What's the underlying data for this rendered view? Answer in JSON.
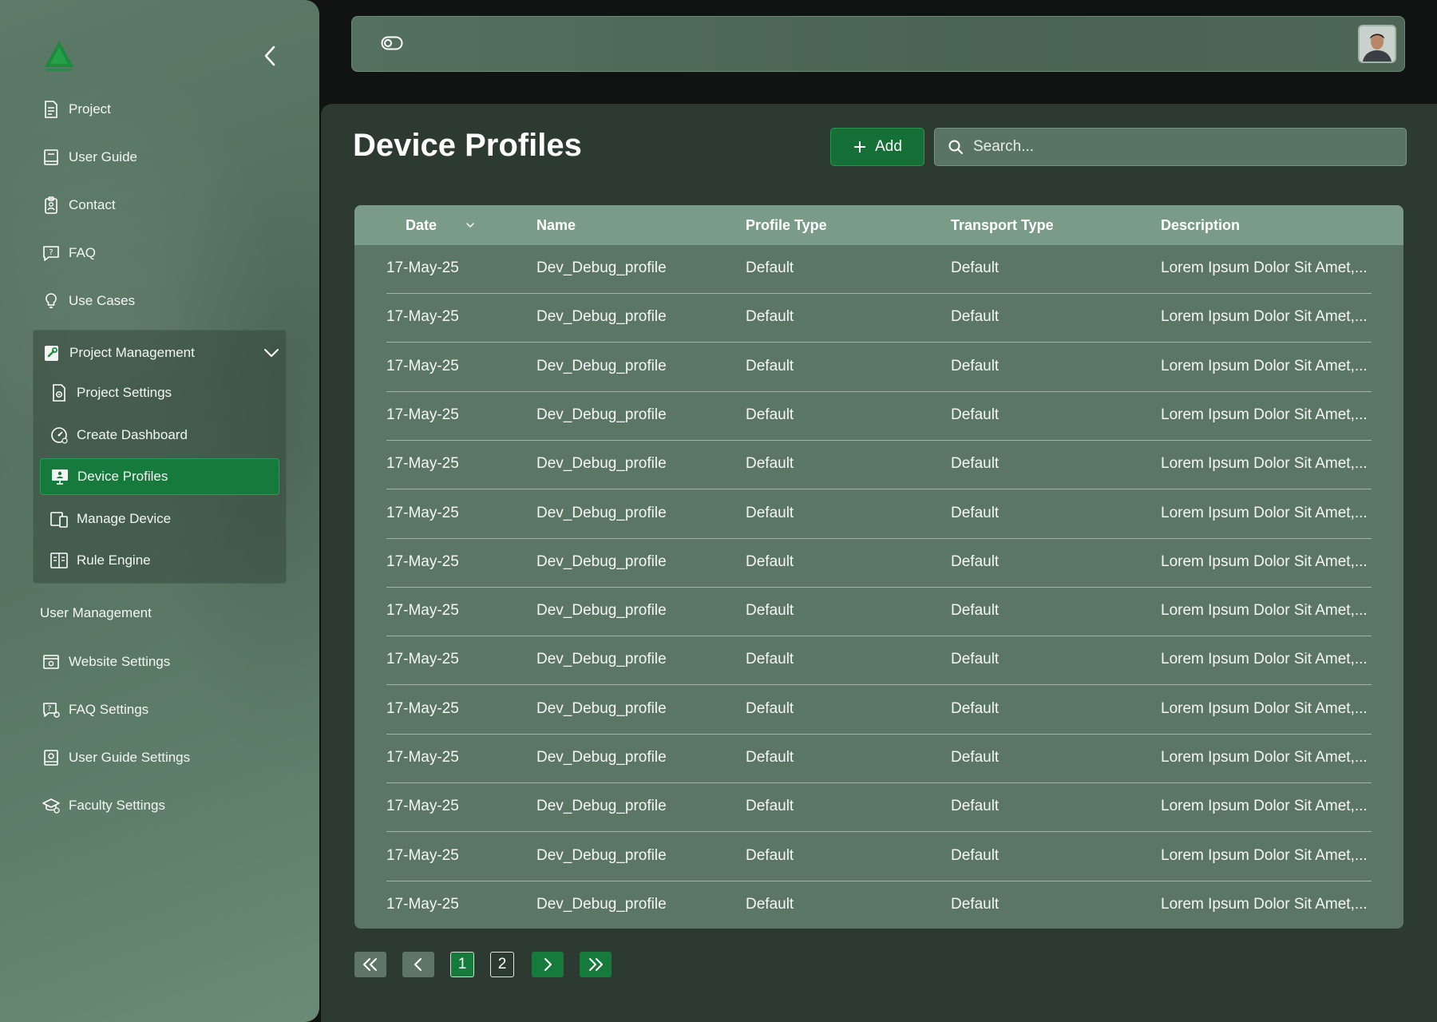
{
  "sidebar": {
    "items": [
      {
        "label": "Project",
        "icon": "document-icon"
      },
      {
        "label": "User Guide",
        "icon": "book-icon"
      },
      {
        "label": "Contact",
        "icon": "contact-card-icon"
      },
      {
        "label": "FAQ",
        "icon": "question-chat-icon"
      },
      {
        "label": "Use Cases",
        "icon": "lightbulb-icon"
      }
    ],
    "group": {
      "label": "Project Management",
      "icon": "wrench-document-icon",
      "items": [
        {
          "label": "Project Settings",
          "icon": "gear-document-icon"
        },
        {
          "label": "Create Dashboard",
          "icon": "gauge-icon"
        },
        {
          "label": "Device Profiles",
          "icon": "monitor-user-icon",
          "active": true
        },
        {
          "label": "Manage Device",
          "icon": "devices-icon"
        },
        {
          "label": "Rule Engine",
          "icon": "open-book-icon"
        }
      ]
    },
    "section_label": "User Management",
    "user_items": [
      {
        "label": "Website Settings",
        "icon": "browser-gear-icon"
      },
      {
        "label": "FAQ Settings",
        "icon": "question-gear-icon"
      },
      {
        "label": "User Guide Settings",
        "icon": "book-gear-icon"
      },
      {
        "label": "Faculty Settings",
        "icon": "graduation-cap-icon"
      }
    ]
  },
  "header": {
    "page_title": "Device Profiles",
    "add_label": "Add",
    "search_placeholder": "Search..."
  },
  "table": {
    "columns": [
      "Date",
      "Name",
      "Profile Type",
      "Transport Type",
      "Description"
    ],
    "rows": [
      [
        "17-May-25",
        "Dev_Debug_profile",
        "Default",
        "Default",
        "Lorem Ipsum Dolor Sit Amet,..."
      ],
      [
        "17-May-25",
        "Dev_Debug_profile",
        "Default",
        "Default",
        "Lorem Ipsum Dolor Sit Amet,..."
      ],
      [
        "17-May-25",
        "Dev_Debug_profile",
        "Default",
        "Default",
        "Lorem Ipsum Dolor Sit Amet,..."
      ],
      [
        "17-May-25",
        "Dev_Debug_profile",
        "Default",
        "Default",
        "Lorem Ipsum Dolor Sit Amet,..."
      ],
      [
        "17-May-25",
        "Dev_Debug_profile",
        "Default",
        "Default",
        "Lorem Ipsum Dolor Sit Amet,..."
      ],
      [
        "17-May-25",
        "Dev_Debug_profile",
        "Default",
        "Default",
        "Lorem Ipsum Dolor Sit Amet,..."
      ],
      [
        "17-May-25",
        "Dev_Debug_profile",
        "Default",
        "Default",
        "Lorem Ipsum Dolor Sit Amet,..."
      ],
      [
        "17-May-25",
        "Dev_Debug_profile",
        "Default",
        "Default",
        "Lorem Ipsum Dolor Sit Amet,..."
      ],
      [
        "17-May-25",
        "Dev_Debug_profile",
        "Default",
        "Default",
        "Lorem Ipsum Dolor Sit Amet,..."
      ],
      [
        "17-May-25",
        "Dev_Debug_profile",
        "Default",
        "Default",
        "Lorem Ipsum Dolor Sit Amet,..."
      ],
      [
        "17-May-25",
        "Dev_Debug_profile",
        "Default",
        "Default",
        "Lorem Ipsum Dolor Sit Amet,..."
      ],
      [
        "17-May-25",
        "Dev_Debug_profile",
        "Default",
        "Default",
        "Lorem Ipsum Dolor Sit Amet,..."
      ],
      [
        "17-May-25",
        "Dev_Debug_profile",
        "Default",
        "Default",
        "Lorem Ipsum Dolor Sit Amet,..."
      ],
      [
        "17-May-25",
        "Dev_Debug_profile",
        "Default",
        "Default",
        "Lorem Ipsum Dolor Sit Amet,..."
      ]
    ]
  },
  "pagination": {
    "pages": [
      "1",
      "2"
    ],
    "current": "1"
  },
  "colors": {
    "accent": "#167a3c",
    "sidebar": "#5c7a67",
    "panel": "#2c3a31",
    "table_header": "#7a9b87"
  }
}
